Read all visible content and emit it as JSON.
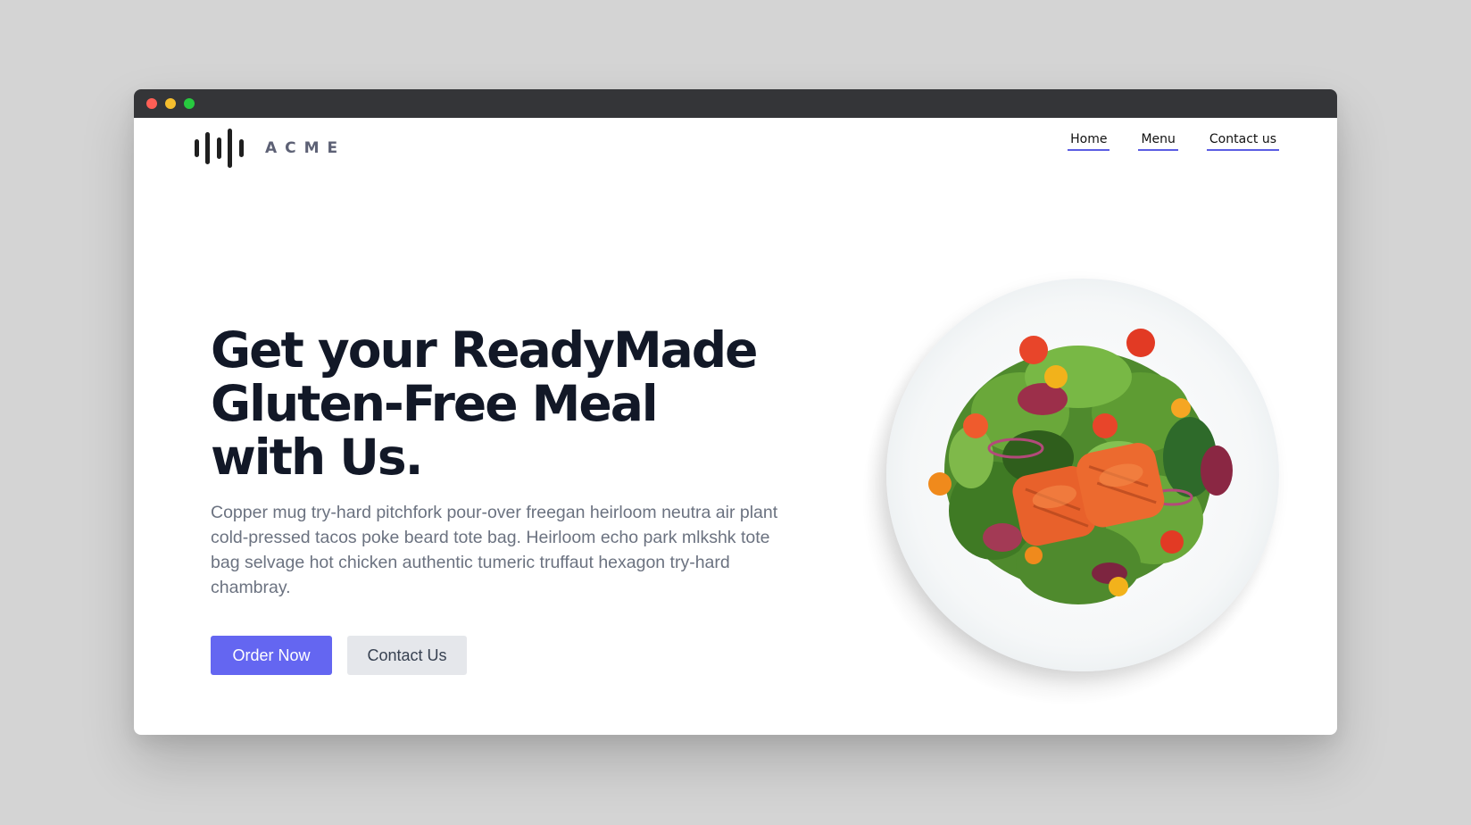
{
  "window": {
    "controls": [
      "close",
      "minimize",
      "maximize"
    ]
  },
  "brand": {
    "name": "ACME",
    "logo_icon": "sound-bars-icon"
  },
  "nav": {
    "links": [
      {
        "label": "Home"
      },
      {
        "label": "Menu"
      },
      {
        "label": "Contact us"
      }
    ]
  },
  "hero": {
    "title": "Get your ReadyMade Gluten-Free Meal with Us.",
    "description": "Copper mug try-hard pitchfork pour-over freegan heirloom neutra air plant cold-pressed tacos poke beard tote bag. Heirloom echo park mlkshk tote bag selvage hot chicken authentic tumeric truffaut hexagon try-hard chambray.",
    "primary_button": "Order Now",
    "secondary_button": "Contact Us",
    "image": "salmon-salad-plate"
  },
  "colors": {
    "accent": "#6466f1",
    "title": "#121827",
    "body_text": "#6b7280",
    "secondary_button_bg": "#e5e7eb",
    "titlebar": "#343538"
  }
}
